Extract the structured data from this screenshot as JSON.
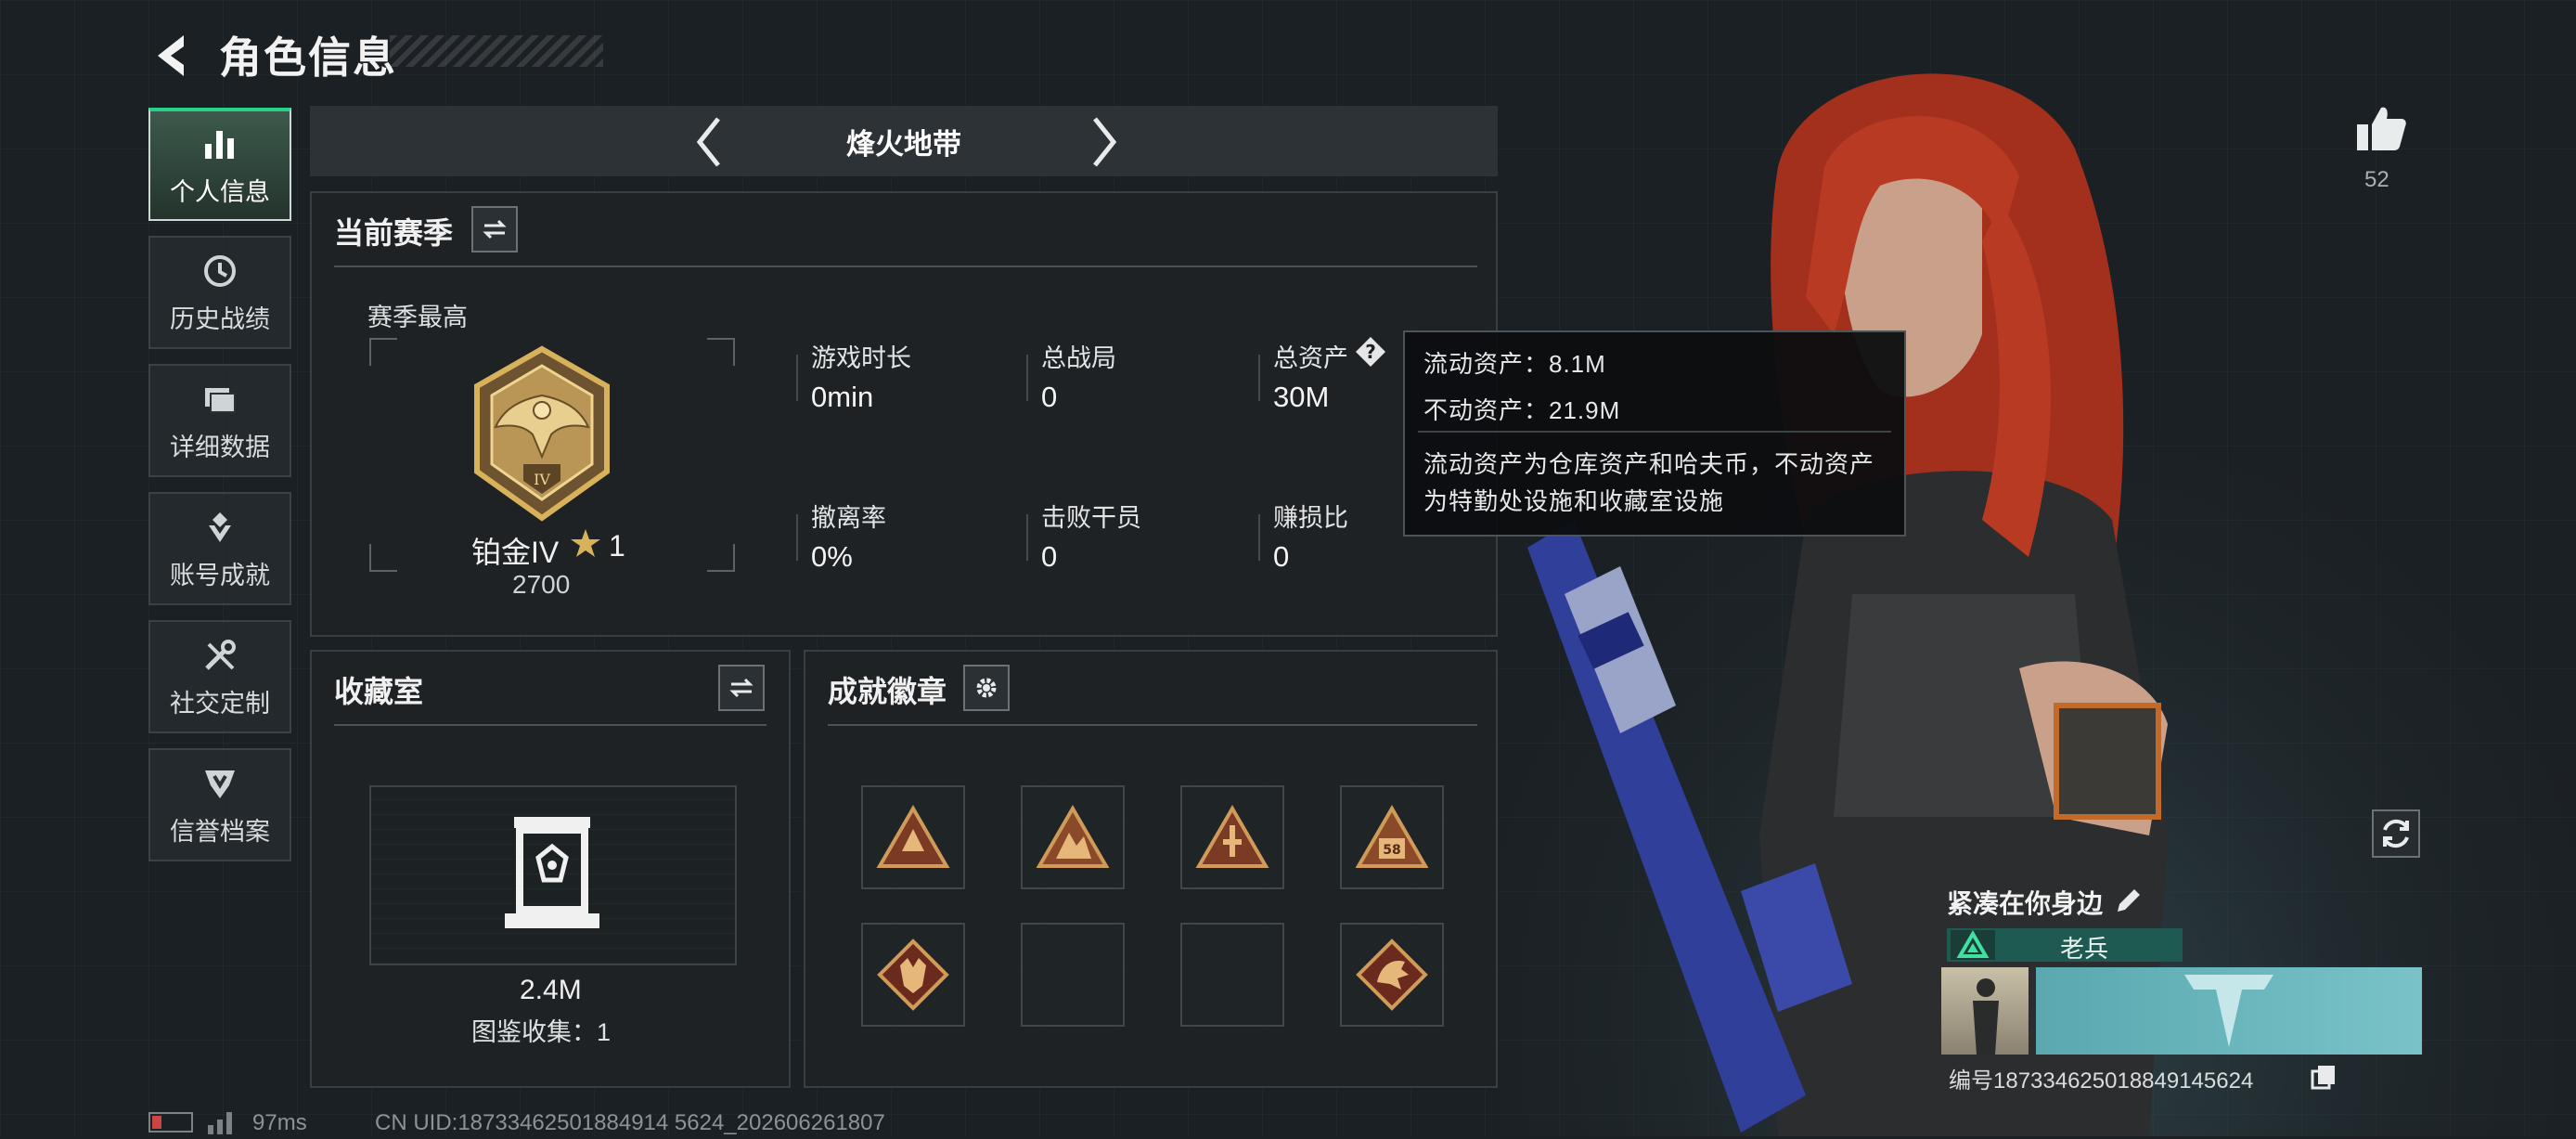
{
  "header": {
    "title": "角色信息"
  },
  "sidebar": {
    "items": [
      {
        "label": "个人信息",
        "icon": "bar-chart-icon",
        "active": true
      },
      {
        "label": "历史战绩",
        "icon": "history-icon",
        "active": false
      },
      {
        "label": "详细数据",
        "icon": "folder-icon",
        "active": false
      },
      {
        "label": "账号成就",
        "icon": "achievement-icon",
        "active": false
      },
      {
        "label": "社交定制",
        "icon": "tools-icon",
        "active": false
      },
      {
        "label": "信誉档案",
        "icon": "credit-shield-icon",
        "active": false
      }
    ]
  },
  "mode_selector": {
    "current": "烽火地带"
  },
  "season": {
    "title": "当前赛季",
    "best_label": "赛季最高",
    "rank_name": "铂金IV",
    "rank_stars": "1",
    "rank_score": "2700",
    "stats": [
      {
        "label": "游戏时长",
        "value": "0min"
      },
      {
        "label": "总战局",
        "value": "0"
      },
      {
        "label": "总资产",
        "value": "30M"
      },
      {
        "label": "撤离率",
        "value": "0%"
      },
      {
        "label": "击败干员",
        "value": "0"
      },
      {
        "label": "赚损比",
        "value": "0"
      }
    ]
  },
  "tooltip": {
    "liquid": "流动资产：8.1M",
    "fixed": "不动资产：21.9M",
    "desc_line1": "流动资产为仓库资产和哈夫币，不动资产",
    "desc_line2": "为特勤处设施和收藏室设施"
  },
  "collection": {
    "title": "收藏室",
    "value": "2.4M",
    "catalog_label": "图鉴收集：1"
  },
  "achievements": {
    "title": "成就徽章",
    "badges": [
      "triangle-badge-1",
      "triangle-badge-2",
      "triangle-badge-3",
      "triangle-badge-58",
      "empty",
      "empty",
      "empty",
      "empty"
    ]
  },
  "likes": {
    "count": "52"
  },
  "player": {
    "name": "紧凑在你身边",
    "tier": "老兵",
    "id_text": "编号1873346250188491456​24"
  },
  "footer": {
    "ping": "97ms",
    "uid": "CN UID:18733462501884914 5624_202606261807"
  },
  "colors": {
    "accent": "#28d18a",
    "bg": "#1b2024",
    "gold": "#d8b25a"
  }
}
